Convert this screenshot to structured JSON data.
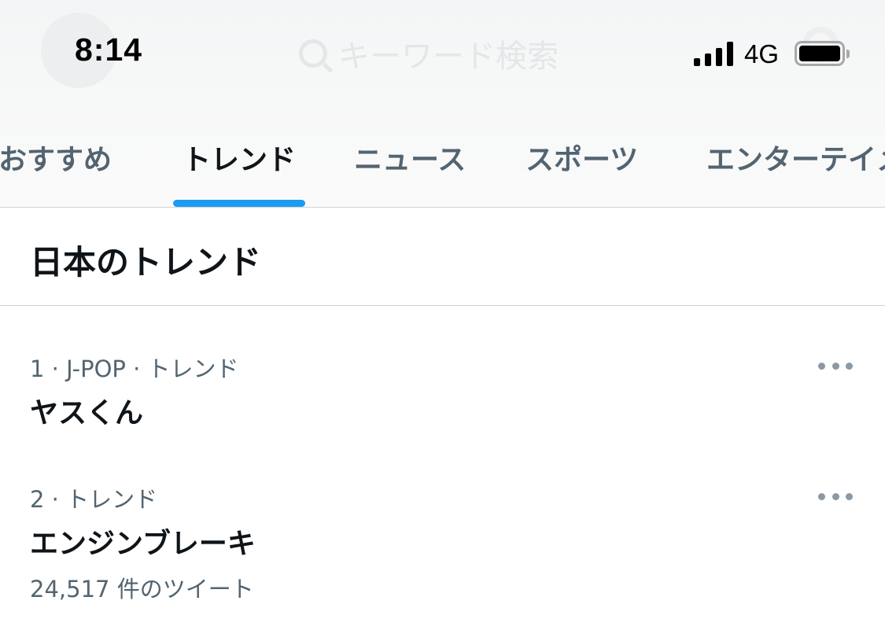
{
  "status_bar": {
    "time": "8:14",
    "network": "4G",
    "signal_bars": 4,
    "battery_level": 1.0
  },
  "search": {
    "placeholder": "キーワード検索"
  },
  "tabs": [
    {
      "label": "おすすめ",
      "active": false
    },
    {
      "label": "トレンド",
      "active": true
    },
    {
      "label": "ニュース",
      "active": false
    },
    {
      "label": "スポーツ",
      "active": false
    },
    {
      "label": "エンターテイメ",
      "active": false
    }
  ],
  "section": {
    "title": "日本のトレンド"
  },
  "trends": [
    {
      "meta": "1 · J-POP · トレンド",
      "name": "ヤスくん",
      "count": ""
    },
    {
      "meta": "2 · トレンド",
      "name": "エンジンブレーキ",
      "count": "24,517 件のツイート"
    }
  ],
  "colors": {
    "accent": "#1d9bf0",
    "text_primary": "#0f1419",
    "text_secondary": "#536471",
    "divider": "#d0d4d8"
  }
}
